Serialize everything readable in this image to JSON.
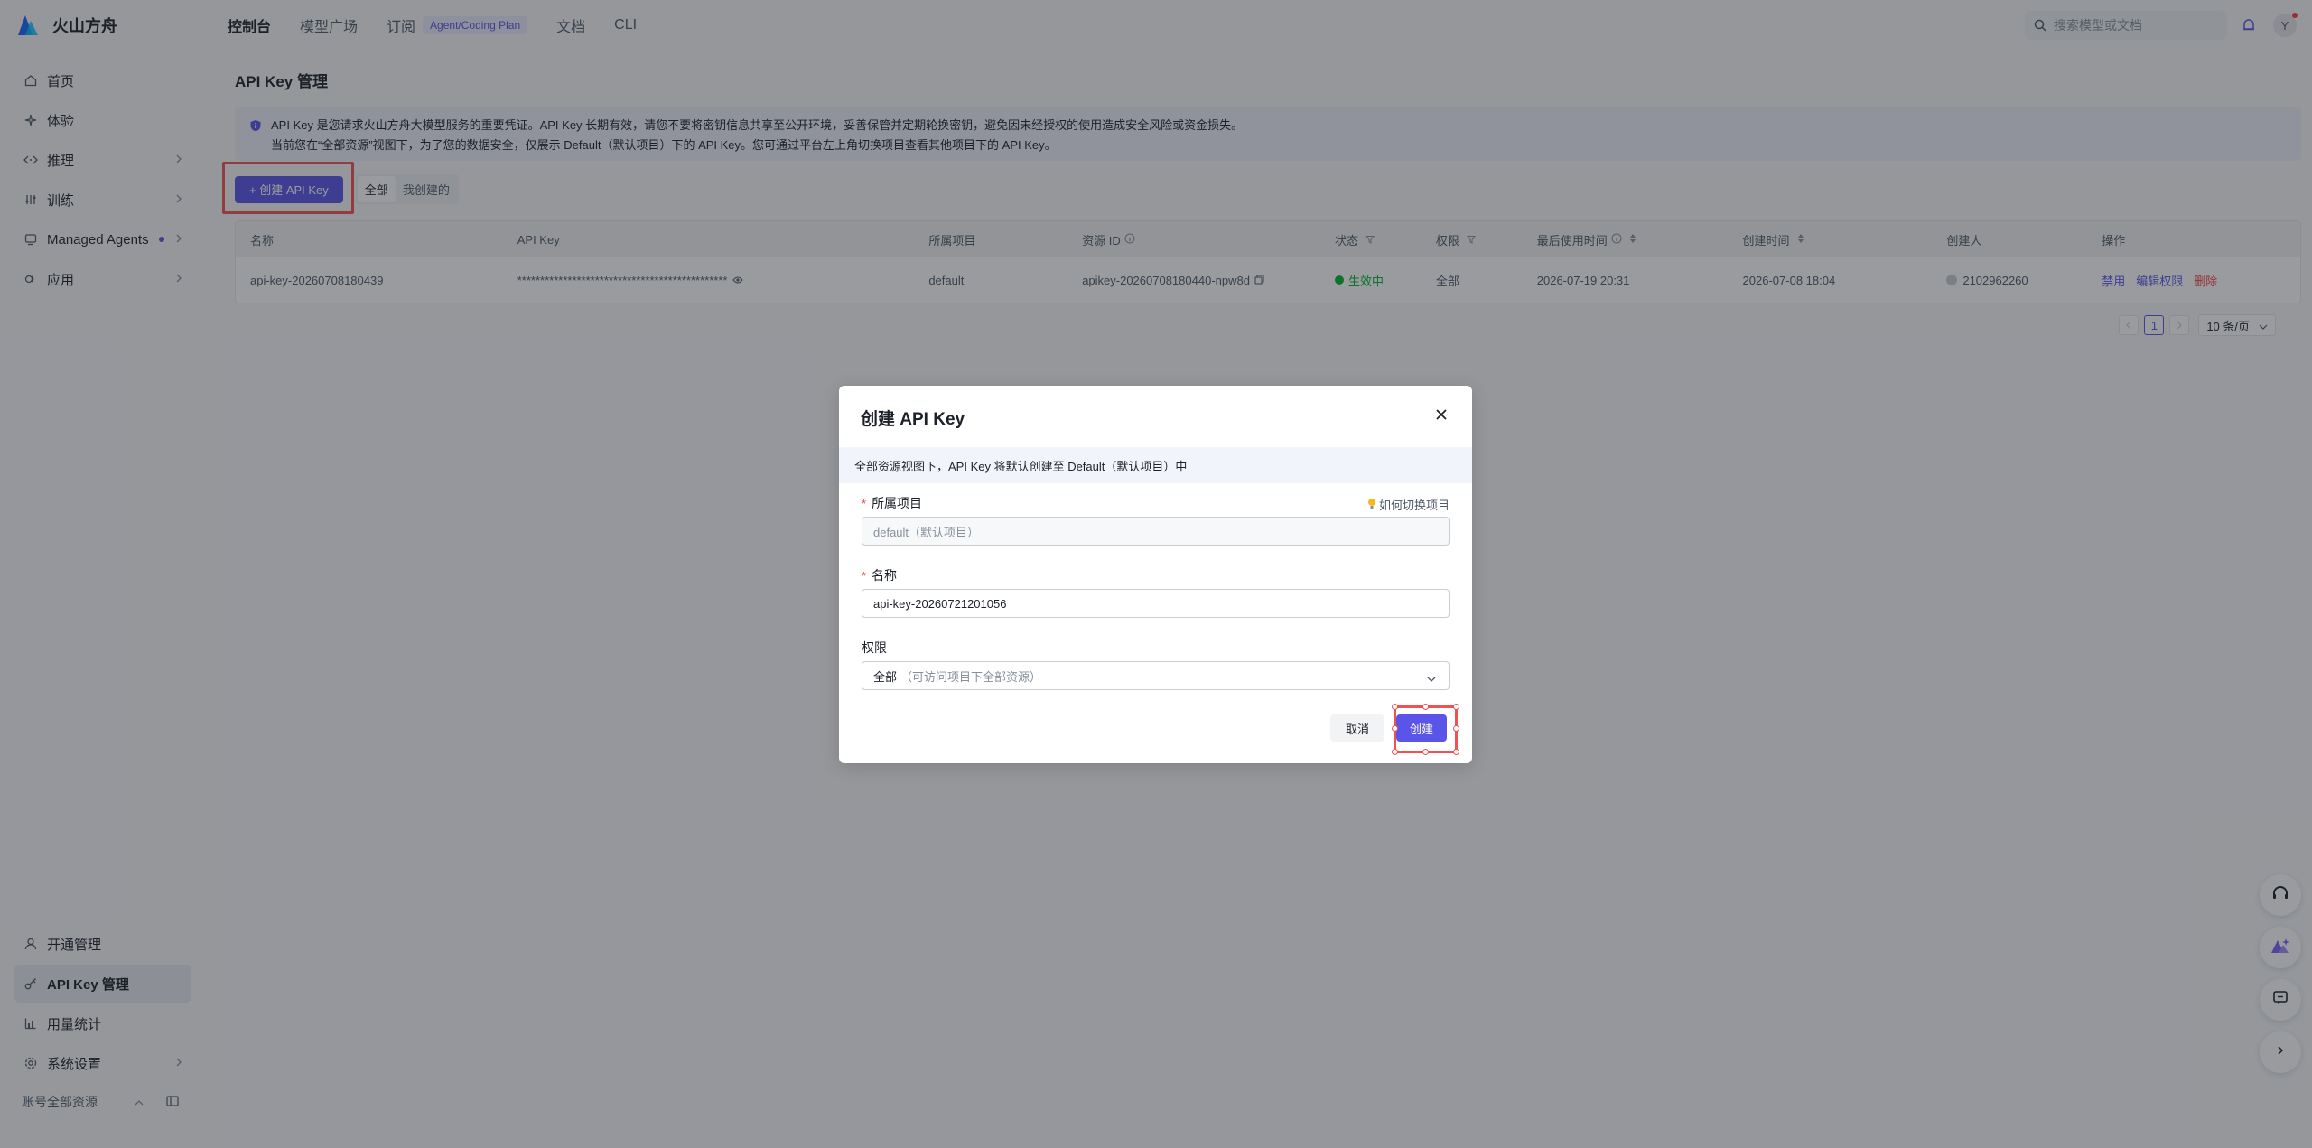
{
  "app": {
    "brand": "火山方舟",
    "colors": {
      "accent": "#5a55e8",
      "danger": "#f53f3f",
      "success": "#00b42a",
      "highlight": "#f05252"
    }
  },
  "topnav": {
    "items": [
      {
        "label": "控制台"
      },
      {
        "label": "模型广场"
      },
      {
        "label": "订阅",
        "badge": "Agent/Coding Plan"
      },
      {
        "label": "文档"
      },
      {
        "label": "CLI"
      }
    ],
    "search_placeholder": "搜索模型或文档",
    "avatar_initial": "Y"
  },
  "sidebar": {
    "items": [
      {
        "label": "首页",
        "icon": "home-icon"
      },
      {
        "label": "体验",
        "icon": "sparkle-icon"
      },
      {
        "label": "推理",
        "icon": "code-icon"
      },
      {
        "label": "训练",
        "icon": "sliders-icon"
      },
      {
        "label": "Managed Agents",
        "icon": "agent-icon"
      },
      {
        "label": "应用",
        "icon": "app-icon"
      }
    ],
    "bottom_items": [
      {
        "label": "开通管理",
        "icon": "user-icon"
      },
      {
        "label": "API Key 管理",
        "icon": "key-icon"
      },
      {
        "label": "用量统计",
        "icon": "chart-icon"
      },
      {
        "label": "系统设置",
        "icon": "gear-icon"
      }
    ],
    "footer": {
      "label": "账号全部资源"
    }
  },
  "page": {
    "title": "API Key 管理",
    "notice_line1": "API Key 是您请求火山方舟大模型服务的重要凭证。API Key 长期有效，请您不要将密钥信息共享至公开环境，妥善保管并定期轮换密钥，避免因未经授权的使用造成安全风险或资金损失。",
    "notice_line2": "当前您在“全部资源”视图下，为了您的数据安全，仅展示 Default（默认项目）下的 API Key。您可通过平台左上角切换项目查看其他项目下的 API Key。",
    "create_button": "+ 创建 API Key",
    "filters": [
      "全部",
      "我创建的"
    ]
  },
  "table": {
    "headers": [
      "名称",
      "API Key",
      "所属项目",
      "资源 ID",
      "状态",
      "权限",
      "最后使用时间",
      "创建时间",
      "创建人",
      "操作"
    ],
    "rows": [
      {
        "name": "api-key-20260708180439",
        "key": "**********************************************",
        "project": "default",
        "resource_id": "apikey-20260708180440-npw8d",
        "status": "生效中",
        "permission": "全部",
        "last_used": "2026-07-19 20:31",
        "created": "2026-07-08 18:04",
        "creator": "2102962260",
        "actions": [
          "禁用",
          "编辑权限",
          "删除"
        ]
      }
    ],
    "pager": {
      "current": "1",
      "page_size": "10 条/页"
    }
  },
  "modal": {
    "title": "创建 API Key",
    "banner": "全部资源视图下，API Key 将默认创建至 Default（默认项目）中",
    "project_label": "所属项目",
    "project_help": "如何切换项目",
    "project_value": "default（默认项目）",
    "name_label": "名称",
    "name_value": "api-key-20260721201056",
    "permission_label": "权限",
    "permission_value": "全部",
    "permission_hint": "（可访问项目下全部资源）",
    "cancel_label": "取消",
    "create_label": "创建"
  }
}
